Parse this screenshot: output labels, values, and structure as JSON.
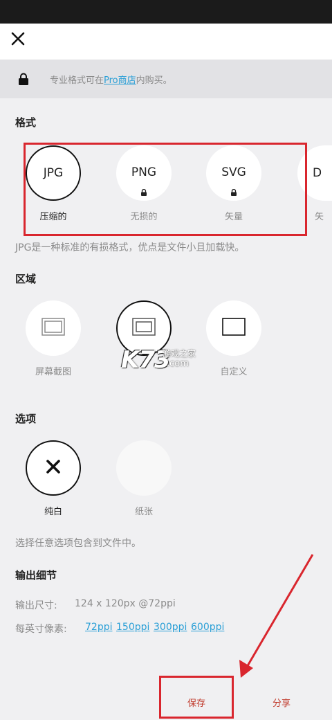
{
  "header": {
    "close_icon": "close-icon"
  },
  "notice": {
    "prefix": "专业格式可在",
    "link": "Pro商店",
    "suffix": "内购买。",
    "icon": "lock-icon"
  },
  "format": {
    "title": "格式",
    "items": [
      {
        "label": "JPG",
        "caption": "压缩的",
        "selected": true,
        "locked": false
      },
      {
        "label": "PNG",
        "caption": "无损的",
        "selected": false,
        "locked": true
      },
      {
        "label": "SVG",
        "caption": "矢量",
        "selected": false,
        "locked": true
      },
      {
        "label": "D",
        "caption": "矢",
        "selected": false,
        "locked": false
      }
    ],
    "description": "JPG是一种标准的有损格式，优点是文件小且加载快。"
  },
  "area": {
    "title": "区域",
    "items": [
      {
        "caption": "屏幕截图",
        "icon": "screenshot-frame-icon"
      },
      {
        "caption": "",
        "icon": "full-canvas-icon"
      },
      {
        "caption": "自定义",
        "icon": "custom-rect-icon"
      }
    ]
  },
  "options": {
    "title": "选项",
    "items": [
      {
        "caption": "纯白",
        "icon": "x-icon"
      },
      {
        "caption": "纸张"
      }
    ],
    "description": "选择任意选项包含到文件中。"
  },
  "output": {
    "title": "输出细节",
    "size_label": "输出尺寸:",
    "size_value": "124 x 120px @72ppi",
    "ppi_label": "每英寸像素:",
    "ppi_options": [
      "72ppi",
      "150ppi",
      "300ppi",
      "600ppi"
    ]
  },
  "actions": {
    "save": "保存",
    "share": "分享"
  },
  "watermark": {
    "logo": "K73",
    "cn": "游戏之家",
    "domain": ".com"
  },
  "colors": {
    "accent_link": "#2a9fd6",
    "annotation_red": "#d9262e",
    "action_red": "#c0392b"
  }
}
